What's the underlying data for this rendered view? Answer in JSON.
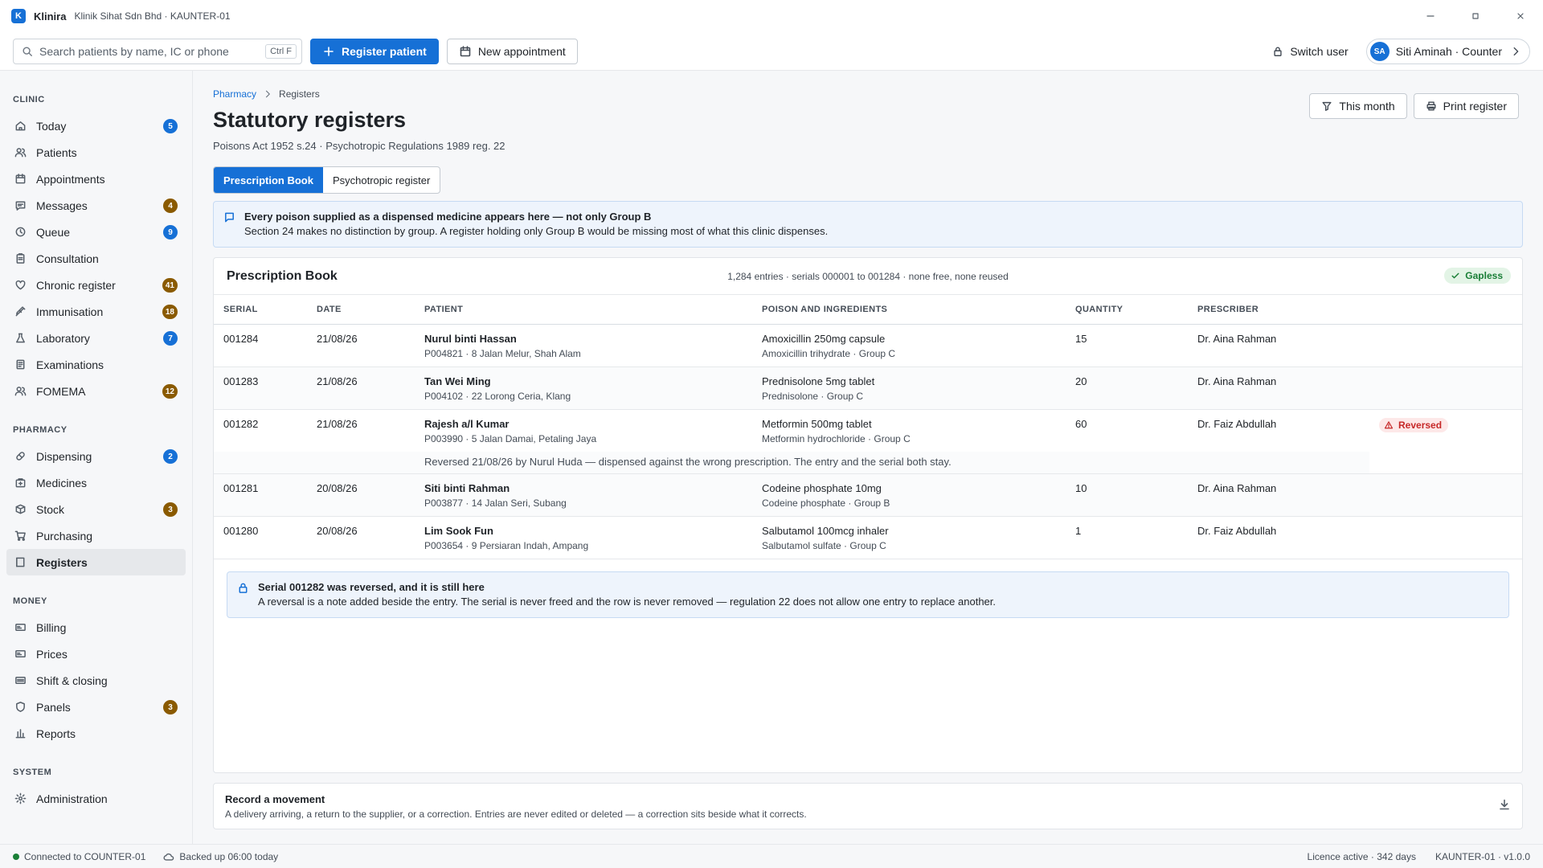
{
  "app": {
    "logo_letter": "K",
    "name": "Klinira",
    "context": "Klinik Sihat Sdn Bhd · KAUNTER-01"
  },
  "toolbar": {
    "search_placeholder": "Search patients by name, IC or phone",
    "search_shortcut": "Ctrl F",
    "register_label": "Register patient",
    "appointment_label": "New appointment",
    "switch_user_label": "Switch user",
    "user_initials": "SA",
    "user_label": "Siti Aminah · Counter"
  },
  "sidebar": {
    "clinic_label": "CLINIC",
    "clinic": [
      {
        "label": "Today",
        "badge": "5"
      },
      {
        "label": "Patients"
      },
      {
        "label": "Appointments"
      },
      {
        "label": "Messages",
        "badge": "4"
      },
      {
        "label": "Queue",
        "badge": "9"
      },
      {
        "label": "Consultation"
      },
      {
        "label": "Chronic register",
        "badge": "41"
      },
      {
        "label": "Immunisation",
        "badge": "18"
      },
      {
        "label": "Laboratory",
        "badge": "7"
      },
      {
        "label": "Examinations"
      },
      {
        "label": "FOMEMA",
        "badge": "12"
      }
    ],
    "pharmacy_label": "PHARMACY",
    "pharmacy": [
      {
        "label": "Dispensing",
        "badge": "2"
      },
      {
        "label": "Medicines"
      },
      {
        "label": "Stock",
        "badge": "3"
      },
      {
        "label": "Purchasing"
      },
      {
        "label": "Registers"
      }
    ],
    "money_label": "MONEY",
    "money": [
      {
        "label": "Billing"
      },
      {
        "label": "Prices"
      },
      {
        "label": "Shift & closing"
      },
      {
        "label": "Panels",
        "badge": "3"
      },
      {
        "label": "Reports"
      }
    ],
    "system_label": "SYSTEM",
    "system": [
      {
        "label": "Administration"
      }
    ]
  },
  "page": {
    "breadcrumb_parent": "Pharmacy",
    "breadcrumb_current": "Registers",
    "title": "Statutory registers",
    "subtitle": "Poisons Act 1952 s.24 · Psychotropic Regulations 1989 reg. 22",
    "filter_label": "This month",
    "print_label": "Print register",
    "tabs": [
      "Prescription Book",
      "Psychotropic register"
    ],
    "info_title": "Every poison supplied as a dispensed medicine appears here — not only Group B",
    "info_text": "Section 24 makes no distinction by group. A register holding only Group B would be missing most of what this clinic dispenses."
  },
  "register": {
    "title": "Prescription Book",
    "meta": "1,284 entries · serials 000001 to 001284 · none free, none reused",
    "status": "Gapless",
    "columns": [
      "SERIAL",
      "DATE",
      "PATIENT",
      "POISON AND INGREDIENTS",
      "QUANTITY",
      "PRESCRIBER"
    ],
    "rows": [
      {
        "serial": "001284",
        "date": "21/08/26",
        "patient": "Nurul binti Hassan",
        "patient_sub": "P004821 · 8 Jalan Melur, Shah Alam",
        "poison": "Amoxicillin 250mg capsule",
        "poison_sub": "Amoxicillin trihydrate · Group C",
        "quantity": "15",
        "prescriber": "Dr. Aina Rahman",
        "status": ""
      },
      {
        "serial": "001283",
        "date": "21/08/26",
        "patient": "Tan Wei Ming",
        "patient_sub": "P004102 · 22 Lorong Ceria, Klang",
        "poison": "Prednisolone 5mg tablet",
        "poison_sub": "Prednisolone · Group C",
        "quantity": "20",
        "prescriber": "Dr. Aina Rahman",
        "status": ""
      },
      {
        "serial": "001282",
        "date": "21/08/26",
        "patient": "Rajesh a/l Kumar",
        "patient_sub": "P003990 · 5 Jalan Damai, Petaling Jaya",
        "poison": "Metformin 500mg tablet",
        "poison_sub": "Metformin hydrochloride · Group C",
        "quantity": "60",
        "prescriber": "Dr. Faiz Abdullah",
        "status": "Reversed"
      },
      {
        "serial": "001281",
        "date": "20/08/26",
        "patient": "Siti binti Rahman",
        "patient_sub": "P003877 · 14 Jalan Seri, Subang",
        "poison": "Codeine phosphate 10mg",
        "poison_sub": "Codeine phosphate · Group B",
        "quantity": "10",
        "prescriber": "Dr. Aina Rahman",
        "status": ""
      },
      {
        "serial": "001280",
        "date": "20/08/26",
        "patient": "Lim Sook Fun",
        "patient_sub": "P003654 · 9 Persiaran Indah, Ampang",
        "poison": "Salbutamol 100mcg inhaler",
        "poison_sub": "Salbutamol sulfate · Group C",
        "quantity": "1",
        "prescriber": "Dr. Faiz Abdullah",
        "status": ""
      }
    ],
    "reversal_note": "Reversed 21/08/26 by Nurul Huda — dispensed against the wrong prescription. The entry and the serial both stay.",
    "lock_title": "Serial 001282 was reversed, and it is still here",
    "lock_text": "A reversal is a note added beside the entry. The serial is never freed and the row is never removed — regulation 22 does not allow one entry to replace another."
  },
  "movement": {
    "title": "Record a movement",
    "text": "A delivery arriving, a return to the supplier, or a correction. Entries are never edited or deleted — a correction sits beside what it corrects."
  },
  "status": {
    "connection": "Connected to COUNTER-01",
    "backup": "Backed up 06:00 today",
    "licence": "Licence active · 342 days",
    "version": "KAUNTER-01 · v1.0.0"
  }
}
